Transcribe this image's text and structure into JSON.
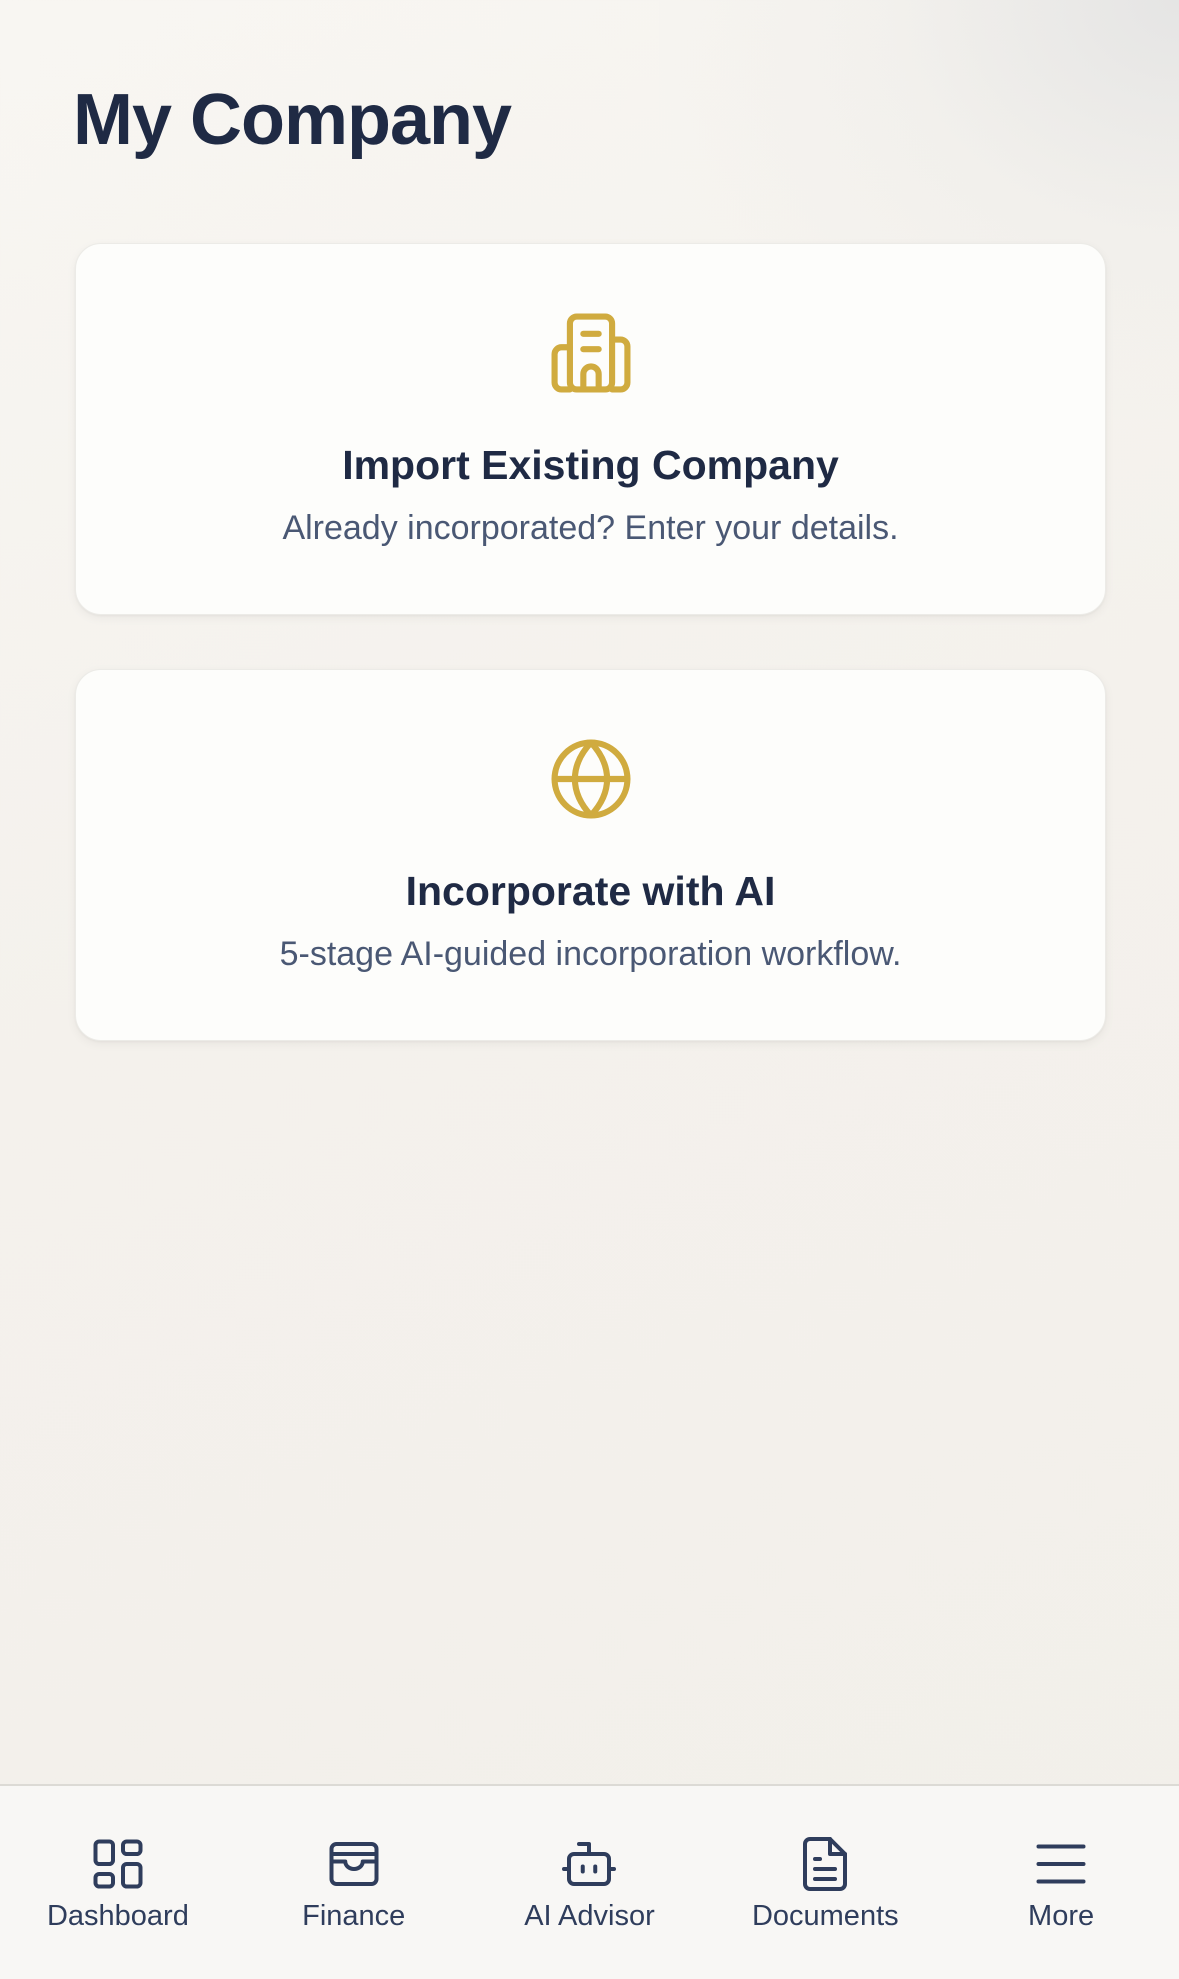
{
  "page": {
    "title": "My Company"
  },
  "cards": [
    {
      "title": "Import Existing Company",
      "description": "Already incorporated? Enter your details.",
      "icon": "building-icon"
    },
    {
      "title": "Incorporate with AI",
      "description": "5-stage AI-guided incorporation workflow.",
      "icon": "globe-icon"
    }
  ],
  "bottom_nav": {
    "items": [
      {
        "label": "Dashboard",
        "icon": "dashboard-grid-icon"
      },
      {
        "label": "Finance",
        "icon": "wallet-icon"
      },
      {
        "label": "AI Advisor",
        "icon": "robot-icon"
      },
      {
        "label": "Documents",
        "icon": "document-icon"
      },
      {
        "label": "More",
        "icon": "hamburger-menu-icon"
      }
    ]
  },
  "colors": {
    "accent_gold": "#d0ab3f",
    "text_primary": "#1f2a44",
    "text_secondary": "#4a5874",
    "nav_icon": "#2f3d5c"
  }
}
